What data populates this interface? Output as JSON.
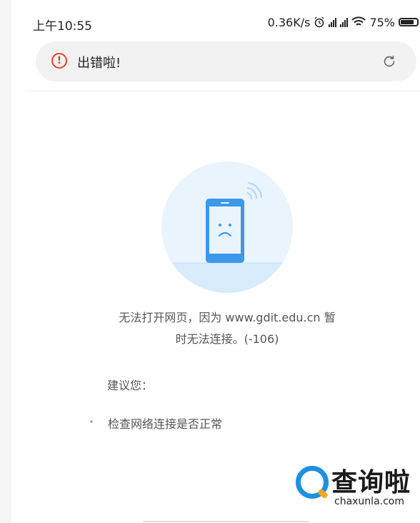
{
  "status_bar": {
    "time": "上午10:55",
    "net_speed": "0.36K/s",
    "battery": "75%"
  },
  "address_bar": {
    "title": "出错啦!",
    "error_icon_glyph": "!"
  },
  "error_page": {
    "message_line1": "无法打开网页，因为 www.gdit.edu.cn 暂",
    "message_line2": "时无法连接。(-106)",
    "suggestion_label": "建议您：",
    "suggestions": [
      "检查网络连接是否正常"
    ]
  },
  "watermark": {
    "name": "查询啦",
    "url": "chaxunla.com"
  },
  "colors": {
    "error_red": "#e2452f",
    "illus_blue": "#3c98ea",
    "illus_bg": "#e9f4fd"
  }
}
